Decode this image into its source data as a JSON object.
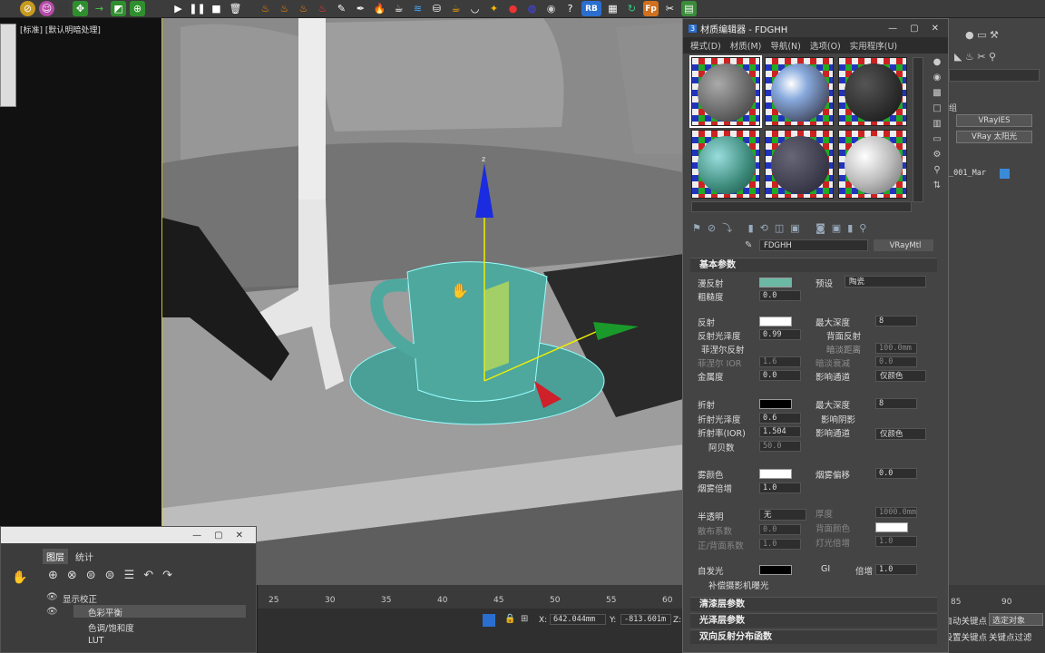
{
  "toolbar": {
    "rb_label": "RB",
    "fp_label": "Fp"
  },
  "viewport": {
    "label": "[标准] [默认明暗处理]",
    "axis_z": "z"
  },
  "material_editor": {
    "title": "材质编辑器 - FDGHH",
    "menu": [
      "模式(D)",
      "材质(M)",
      "导航(N)",
      "选项(O)",
      "实用程序(U)"
    ],
    "material_name": "FDGHH",
    "material_type": "VRayMtl",
    "sections": {
      "basic": "基本参数",
      "coat": "清漆层参数",
      "sheen": "光泽层参数",
      "brdf": "双向反射分布函数"
    },
    "diffuse": {
      "label": "漫反射",
      "preset_label": "预设",
      "preset_value": "陶瓷"
    },
    "roughness": {
      "label": "粗糙度",
      "value": "0.0"
    },
    "reflect": {
      "label": "反射",
      "max_depth_label": "最大深度",
      "max_depth": "8",
      "gloss_label": "反射光泽度",
      "gloss": "0.99",
      "back_reflect": "背面反射",
      "fresnel": "菲涅尔反射",
      "dim_dist": "暗淡距离",
      "dim_dist_val": "100.0mm",
      "fresnel_ior": "菲涅尔 IOR",
      "fresnel_ior_val": "1.6",
      "dim_falloff": "暗淡衰减",
      "dim_falloff_val": "0.0",
      "metal_label": "金属度",
      "metal": "0.0",
      "affect_ch": "影响通道",
      "affect_val": "仅颜色"
    },
    "refract": {
      "label": "折射",
      "max_depth_label": "最大深度",
      "max_depth": "8",
      "gloss_label": "折射光泽度",
      "gloss": "0.6",
      "affect_shadow": "影响阴影",
      "ior_label": "折射率(IOR)",
      "ior": "1.504",
      "affect_ch": "影响通道",
      "affect_val": "仅颜色",
      "abbe": "阿贝数",
      "abbe_val": "50.0"
    },
    "fog": {
      "label": "雾颜色",
      "bias_label": "烟雾偏移",
      "bias": "0.0",
      "mult_label": "烟雾倍增",
      "mult": "1.0"
    },
    "translucency": {
      "label": "半透明",
      "value": "无",
      "thickness": "厚度",
      "thickness_val": "1000.0mm",
      "scatter": "散布系数",
      "scatter_val": "0.0",
      "back_color": "背面颜色",
      "fb": "正/背面系数",
      "fb_val": "1.0",
      "light_mult": "灯光倍增",
      "light_mult_val": "1.0"
    },
    "self_illum": {
      "label": "自发光",
      "gi": "GI",
      "mult_label": "倍增",
      "mult": "1.0",
      "comp": "补偿摄影机曝光"
    }
  },
  "cmdpanel": {
    "btn1": "VRayIES",
    "btn2": "VRay 太阳光",
    "label_a": "组",
    "item": "_001_Mar"
  },
  "timeline": {
    "ticks": [
      "25",
      "30",
      "35",
      "40",
      "45",
      "50",
      "55",
      "60"
    ],
    "tick_right": "85",
    "tick_right2": "90"
  },
  "status": {
    "x_label": "X:",
    "x_val": "642.044mm",
    "y_label": "Y:",
    "y_val": "-813.601m",
    "z_label": "Z:"
  },
  "rightbottom": {
    "autokey": "自动关键点",
    "sel_label": "选定对象",
    "setkey": "设置关键点",
    "filters": "关键点过滤"
  },
  "layers": {
    "tabs": [
      "图层",
      "统计"
    ],
    "items": [
      "显示校正",
      "色彩平衡",
      "色调/饱和度",
      "LUT"
    ]
  }
}
